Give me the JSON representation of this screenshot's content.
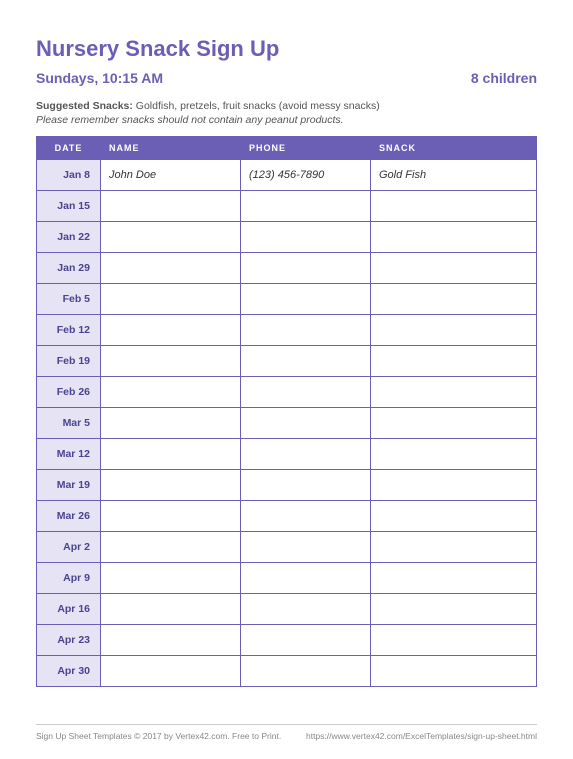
{
  "title": "Nursery Snack Sign Up",
  "schedule": "Sundays, 10:15 AM",
  "count_label": "8 children",
  "suggest_label": "Suggested Snacks:",
  "suggest_text": " Goldfish, pretzels, fruit snacks (avoid messy snacks)",
  "note": "Please remember snacks should not contain any peanut products.",
  "columns": {
    "date": "DATE",
    "name": "NAME",
    "phone": "PHONE",
    "snack": "SNACK"
  },
  "rows": [
    {
      "date": "Jan 8",
      "name": "John Doe",
      "phone": "(123) 456-7890",
      "snack": "Gold Fish"
    },
    {
      "date": "Jan 15",
      "name": "",
      "phone": "",
      "snack": ""
    },
    {
      "date": "Jan 22",
      "name": "",
      "phone": "",
      "snack": ""
    },
    {
      "date": "Jan 29",
      "name": "",
      "phone": "",
      "snack": ""
    },
    {
      "date": "Feb 5",
      "name": "",
      "phone": "",
      "snack": ""
    },
    {
      "date": "Feb 12",
      "name": "",
      "phone": "",
      "snack": ""
    },
    {
      "date": "Feb 19",
      "name": "",
      "phone": "",
      "snack": ""
    },
    {
      "date": "Feb 26",
      "name": "",
      "phone": "",
      "snack": ""
    },
    {
      "date": "Mar 5",
      "name": "",
      "phone": "",
      "snack": ""
    },
    {
      "date": "Mar 12",
      "name": "",
      "phone": "",
      "snack": ""
    },
    {
      "date": "Mar 19",
      "name": "",
      "phone": "",
      "snack": ""
    },
    {
      "date": "Mar 26",
      "name": "",
      "phone": "",
      "snack": ""
    },
    {
      "date": "Apr 2",
      "name": "",
      "phone": "",
      "snack": ""
    },
    {
      "date": "Apr 9",
      "name": "",
      "phone": "",
      "snack": ""
    },
    {
      "date": "Apr 16",
      "name": "",
      "phone": "",
      "snack": ""
    },
    {
      "date": "Apr 23",
      "name": "",
      "phone": "",
      "snack": ""
    },
    {
      "date": "Apr 30",
      "name": "",
      "phone": "",
      "snack": ""
    }
  ],
  "footer": {
    "left": "Sign Up Sheet Templates © 2017 by Vertex42.com. Free to Print.",
    "right": "https://www.vertex42.com/ExcelTemplates/sign-up-sheet.html"
  }
}
